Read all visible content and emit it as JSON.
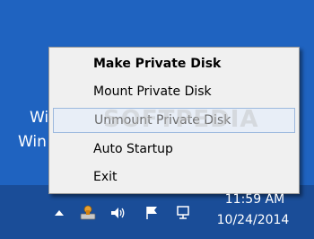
{
  "desktop": {
    "line1": "Wi",
    "line2": "Win"
  },
  "context_menu": {
    "items": [
      {
        "label": "Make Private Disk",
        "bold": true
      },
      {
        "label": "Mount Private Disk",
        "bold": false
      },
      {
        "label": "Unmount Private Disk",
        "bold": false,
        "highlighted": true
      },
      {
        "label": "Auto Startup",
        "bold": false
      },
      {
        "label": "Exit",
        "bold": false
      }
    ]
  },
  "watermark": "SOFTPEDIA",
  "tray": {
    "icons": [
      "chevron-up-icon",
      "private-disk-icon",
      "speaker-icon",
      "flag-icon",
      "network-icon"
    ],
    "time": "11:59 AM",
    "date": "10/24/2014"
  },
  "colors": {
    "desktop": "#1f63c0",
    "taskbar": "#1a4d98",
    "menu_bg": "#f0f0f0",
    "highlight_border": "#9db9de"
  }
}
